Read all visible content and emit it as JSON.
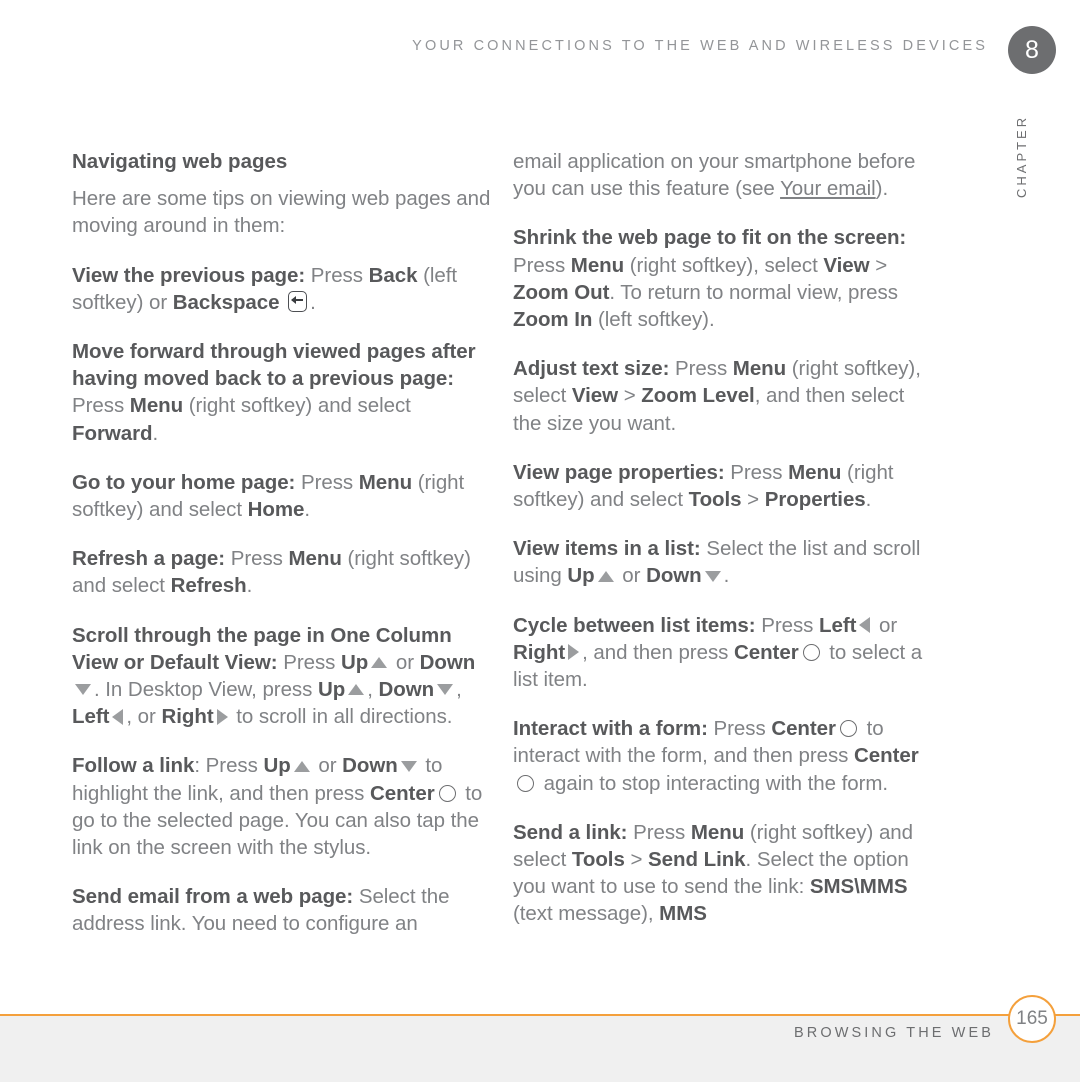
{
  "header": {
    "title": "Your connections to the web and wireless devices",
    "chapter_number": "8",
    "chapter_label": "Chapter"
  },
  "footer": {
    "title": "Browsing the web",
    "page_number": "165",
    "rule_color": "#f4a03c",
    "background": "#f0f0f0"
  },
  "colors": {
    "body_text": "#808285",
    "bold_text": "#58595b",
    "icon_gray": "#9b9d9f",
    "accent_orange": "#f4a03c",
    "badge_gray": "#6d6e70"
  },
  "left_column": {
    "section_heading": "Navigating web pages",
    "intro": "Here are some tips on viewing web pages and moving around in them:",
    "tips": [
      {
        "term": "View the previous page:",
        "body_1": " Press ",
        "bold_1": "Back",
        "body_2": " (left softkey) or ",
        "bold_2": "Backspace",
        "icon": "backspace-key-icon",
        "body_3": "."
      },
      {
        "term": "Move forward through viewed pages after having moved back to a previous page:",
        "body_1": " Press ",
        "bold_1": "Menu",
        "body_2": " (right softkey) and select ",
        "bold_2": "Forward",
        "body_3": "."
      },
      {
        "term": "Go to your home page:",
        "body_1": " Press ",
        "bold_1": "Menu",
        "body_2": " (right softkey) and select ",
        "bold_2": "Home",
        "body_3": "."
      },
      {
        "term": "Refresh a page:",
        "body_1": " Press ",
        "bold_1": "Menu",
        "body_2": " (right softkey) and select ",
        "bold_2": "Refresh",
        "body_3": "."
      },
      {
        "term": "Scroll through the page in One Column View or Default View:",
        "body_1": " Press ",
        "bold_1": "Up",
        "body_2": " or ",
        "bold_2": "Down",
        "body_3": ". In Desktop View, press ",
        "bold_3": "Up",
        "body_4": ", ",
        "bold_4": "Down",
        "body_5": ", ",
        "bold_5": "Left",
        "body_6": ", or ",
        "bold_6": "Right",
        "body_7": " to scroll in all directions."
      },
      {
        "term": "Follow a link",
        "colon": ":",
        "body_1": " Press ",
        "bold_1": "Up",
        "body_2": " or ",
        "bold_2": "Down",
        "body_3": " to highlight the link, and then press ",
        "bold_3": "Center",
        "body_4": " to go to the selected page. You can also tap the link on the screen with the stylus."
      },
      {
        "term": "Send email from a web page:",
        "body_1": " Select the address link. You need to configure an"
      }
    ]
  },
  "right_column": {
    "continuation": {
      "body_1": "email application on your smartphone before you can use this feature (see ",
      "link": "Your email",
      "body_2": ")."
    },
    "tips": [
      {
        "term": "Shrink the web page to fit on the screen:",
        "body_1": " Press ",
        "bold_1": "Menu",
        "body_2": " (right softkey), select ",
        "bold_2": "View",
        "body_3": " > ",
        "bold_3": "Zoom Out",
        "body_4": ". To return to normal view, press ",
        "bold_4": "Zoom In",
        "body_5": " (left softkey)."
      },
      {
        "term": "Adjust text size:",
        "body_1": " Press ",
        "bold_1": "Menu",
        "body_2": " (right softkey), select ",
        "bold_2": "View",
        "body_3": " > ",
        "bold_3": "Zoom Level",
        "body_4": ", and then select the size you want."
      },
      {
        "term": "View page properties:",
        "body_1": " Press ",
        "bold_1": "Menu",
        "body_2": " (right softkey) and select ",
        "bold_2": "Tools",
        "body_3": " > ",
        "bold_3": "Properties",
        "body_4": "."
      },
      {
        "term": "View items in a list:",
        "body_1": " Select the list and scroll using ",
        "bold_1": "Up",
        "body_2": " or ",
        "bold_2": "Down",
        "body_3": "."
      },
      {
        "term": "Cycle between list items:",
        "body_1": " Press ",
        "bold_1": "Left",
        "body_2": " or ",
        "bold_2": "Right",
        "body_3": ", and then press ",
        "bold_3": "Center",
        "body_4": " to select a list item."
      },
      {
        "term": "Interact with a form:",
        "body_1": " Press ",
        "bold_1": "Center",
        "body_2": " to interact with the form, and then press ",
        "bold_2": "Center",
        "body_3": " again to stop interacting with the form."
      },
      {
        "term": "Send a link:",
        "body_1": " Press ",
        "bold_1": "Menu",
        "body_2": " (right softkey) and select ",
        "bold_2": "Tools",
        "body_3": " > ",
        "bold_3": "Send Link",
        "body_4": ". Select the option you want to use to send the link: ",
        "bold_4": "SMS\\MMS",
        "body_5": " (text message), ",
        "bold_5": "MMS"
      }
    ]
  }
}
